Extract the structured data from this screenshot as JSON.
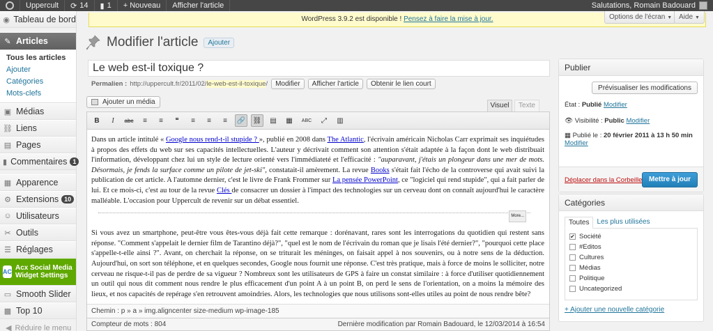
{
  "adminbar": {
    "site": "Uppercult",
    "updates": "14",
    "comments": "1",
    "new_label": "+ Nouveau",
    "view_post": "Afficher l'article",
    "greeting": "Salutations, Romain Badouard"
  },
  "sidebar": {
    "dashboard": "Tableau de bord",
    "articles": "Articles",
    "sub": [
      "Tous les articles",
      "Ajouter",
      "Catégories",
      "Mots-clefs"
    ],
    "media": "Médias",
    "links": "Liens",
    "pages": "Pages",
    "comments": "Commentaires",
    "comments_badge": "1",
    "appearance": "Apparence",
    "extensions": "Extensions",
    "extensions_badge": "10",
    "users": "Utilisateurs",
    "tools": "Outils",
    "settings": "Réglages",
    "acx": "Acx Social Media Widget Settings",
    "acx_icon": "AC",
    "slider": "Smooth Slider",
    "top10": "Top 10",
    "collapse": "Réduire le menu"
  },
  "nag": {
    "text": "WordPress 3.9.2 est disponible !",
    "link": "Pensez à faire la mise à jour."
  },
  "screen_options": "Options de l'écran",
  "help": "Aide",
  "page": {
    "title": "Modifier l'article",
    "add_new": "Ajouter"
  },
  "post": {
    "title": "Le web est-il toxique ?",
    "permalink_label": "Permalien :",
    "permalink_base": "http://uppercult.fr/2011/02/",
    "permalink_slug": "le-web-est-il-toxique",
    "permalink_tail": "/",
    "btn_modify": "Modifier",
    "btn_view": "Afficher l'article",
    "btn_short": "Obtenir le lien court"
  },
  "editor": {
    "add_media": "Ajouter un média",
    "tab_visual": "Visuel",
    "tab_text": "Texte",
    "toolbar": [
      "B",
      "I",
      "abc",
      "≡",
      "≡",
      "❝",
      "≡",
      "≡",
      "≡",
      "🔗",
      "⛓",
      "▤",
      "▦",
      "ABC",
      "⤢",
      "▥"
    ],
    "para1": {
      "t1": "Dans un article intitulé « ",
      "l1": "Google nous rend-t-il stupide ? ",
      "t2": "», publié en 2008 dans ",
      "l2": "The Atlantic",
      "t3": ", l'écrivain américain Nicholas Carr exprimait ses inquiétudes à propos des effets du web sur ses capacités intellectuelles. L'auteur y décrivait comment son attention s'était adaptée à la façon dont le web distribuait l'information, développant chez lui un style de lecture orienté vers l'immédiateté et l'efficacité : ",
      "i1": "\"auparavant, j'étais un plongeur dans une mer de mots. Désormais, je fends la surface comme un pilote de jet-ski\"",
      "t4": ", constatait-il amèrement. La revue ",
      "l3": "Books",
      "t5": " s'était fait l'écho de la controverse qui avait suivi la publication de cet article. A l'automne dernier, c'est le livre de Frank Frommer sur ",
      "l4": "La pensée PowerPoint",
      "t6": ", ce \"logiciel qui rend stupide\", qui a fait parler de lui. Et ce mois-ci, c'est au tour de la revue ",
      "l5": "Clés ",
      "t7": "de consacrer un dossier à l'impact des technologies sur un cerveau dont on connaît aujourd'hui le caractère malléable. L'occasion pour Uppercult de revenir sur un débat essentiel."
    },
    "more": "More...",
    "para2": "Si vous avez un smartphone, peut-être vous êtes-vous déjà fait cette remarque : dorénavant, rares sont les interrogations du quotidien qui restent sans réponse. \"Comment s'appelait le dernier film de Tarantino déjà?\", \"quel est le nom de l'écrivain du roman que je lisais l'été dernier?\", \"pourquoi cette place s'appelle-t-elle ainsi ?\". Avant, on cherchait la réponse, on se triturait les méninges, on faisait appel à nos souvenirs, ou à notre sens de la déduction. Aujourd'hui, on sort son téléphone, et en quelques secondes, Google nous fournit une réponse. C'est très pratique, mais à force de moins le solliciter, notre cerveau ne risque-t-il pas de perdre de sa vigueur ? Nombreux sont les utilisateurs de GPS à faire un constat similaire : à force d'utiliser quotidiennement un outil qui nous dit comment nous rendre le plus efficacement d'un point A à un point B, on perd le sens de l'orientation, on a moins la mémoire des lieux, et nos capacités de repérage s'en retrouvent amoindries. Alors, les technologies que nous utilisons sont-elles utiles au point de nous rendre bête?",
    "path": "Chemin : p » a » img.aligncenter size-medium wp-image-185",
    "word_count": "Compteur de mots : 804",
    "last_modified": "Dernière modification par Romain Badouard, le 12/03/2014 à 16:54"
  },
  "publish": {
    "title": "Publier",
    "preview": "Prévisualiser les modifications",
    "status_label": "État :",
    "status_value": "Publié",
    "visibility_label": "Visibilité :",
    "visibility_value": "Public",
    "published_label": "Publié le :",
    "published_value": "20 février 2011 à 13 h 50 min",
    "modify": "Modifier",
    "trash": "Déplacer dans la Corbeille",
    "update": "Mettre à jour"
  },
  "categories": {
    "title": "Catégories",
    "tab_all": "Toutes",
    "tab_popular": "Les plus utilisées",
    "items": [
      {
        "label": "Société",
        "checked": "✔"
      },
      {
        "label": "#Edito​s",
        "checked": ""
      },
      {
        "label": "Cultures",
        "checked": ""
      },
      {
        "label": "Médias",
        "checked": ""
      },
      {
        "label": "Politique",
        "checked": ""
      },
      {
        "label": "Uncategorized",
        "checked": ""
      }
    ],
    "add_new": "+ Ajouter une nouvelle catégorie"
  }
}
